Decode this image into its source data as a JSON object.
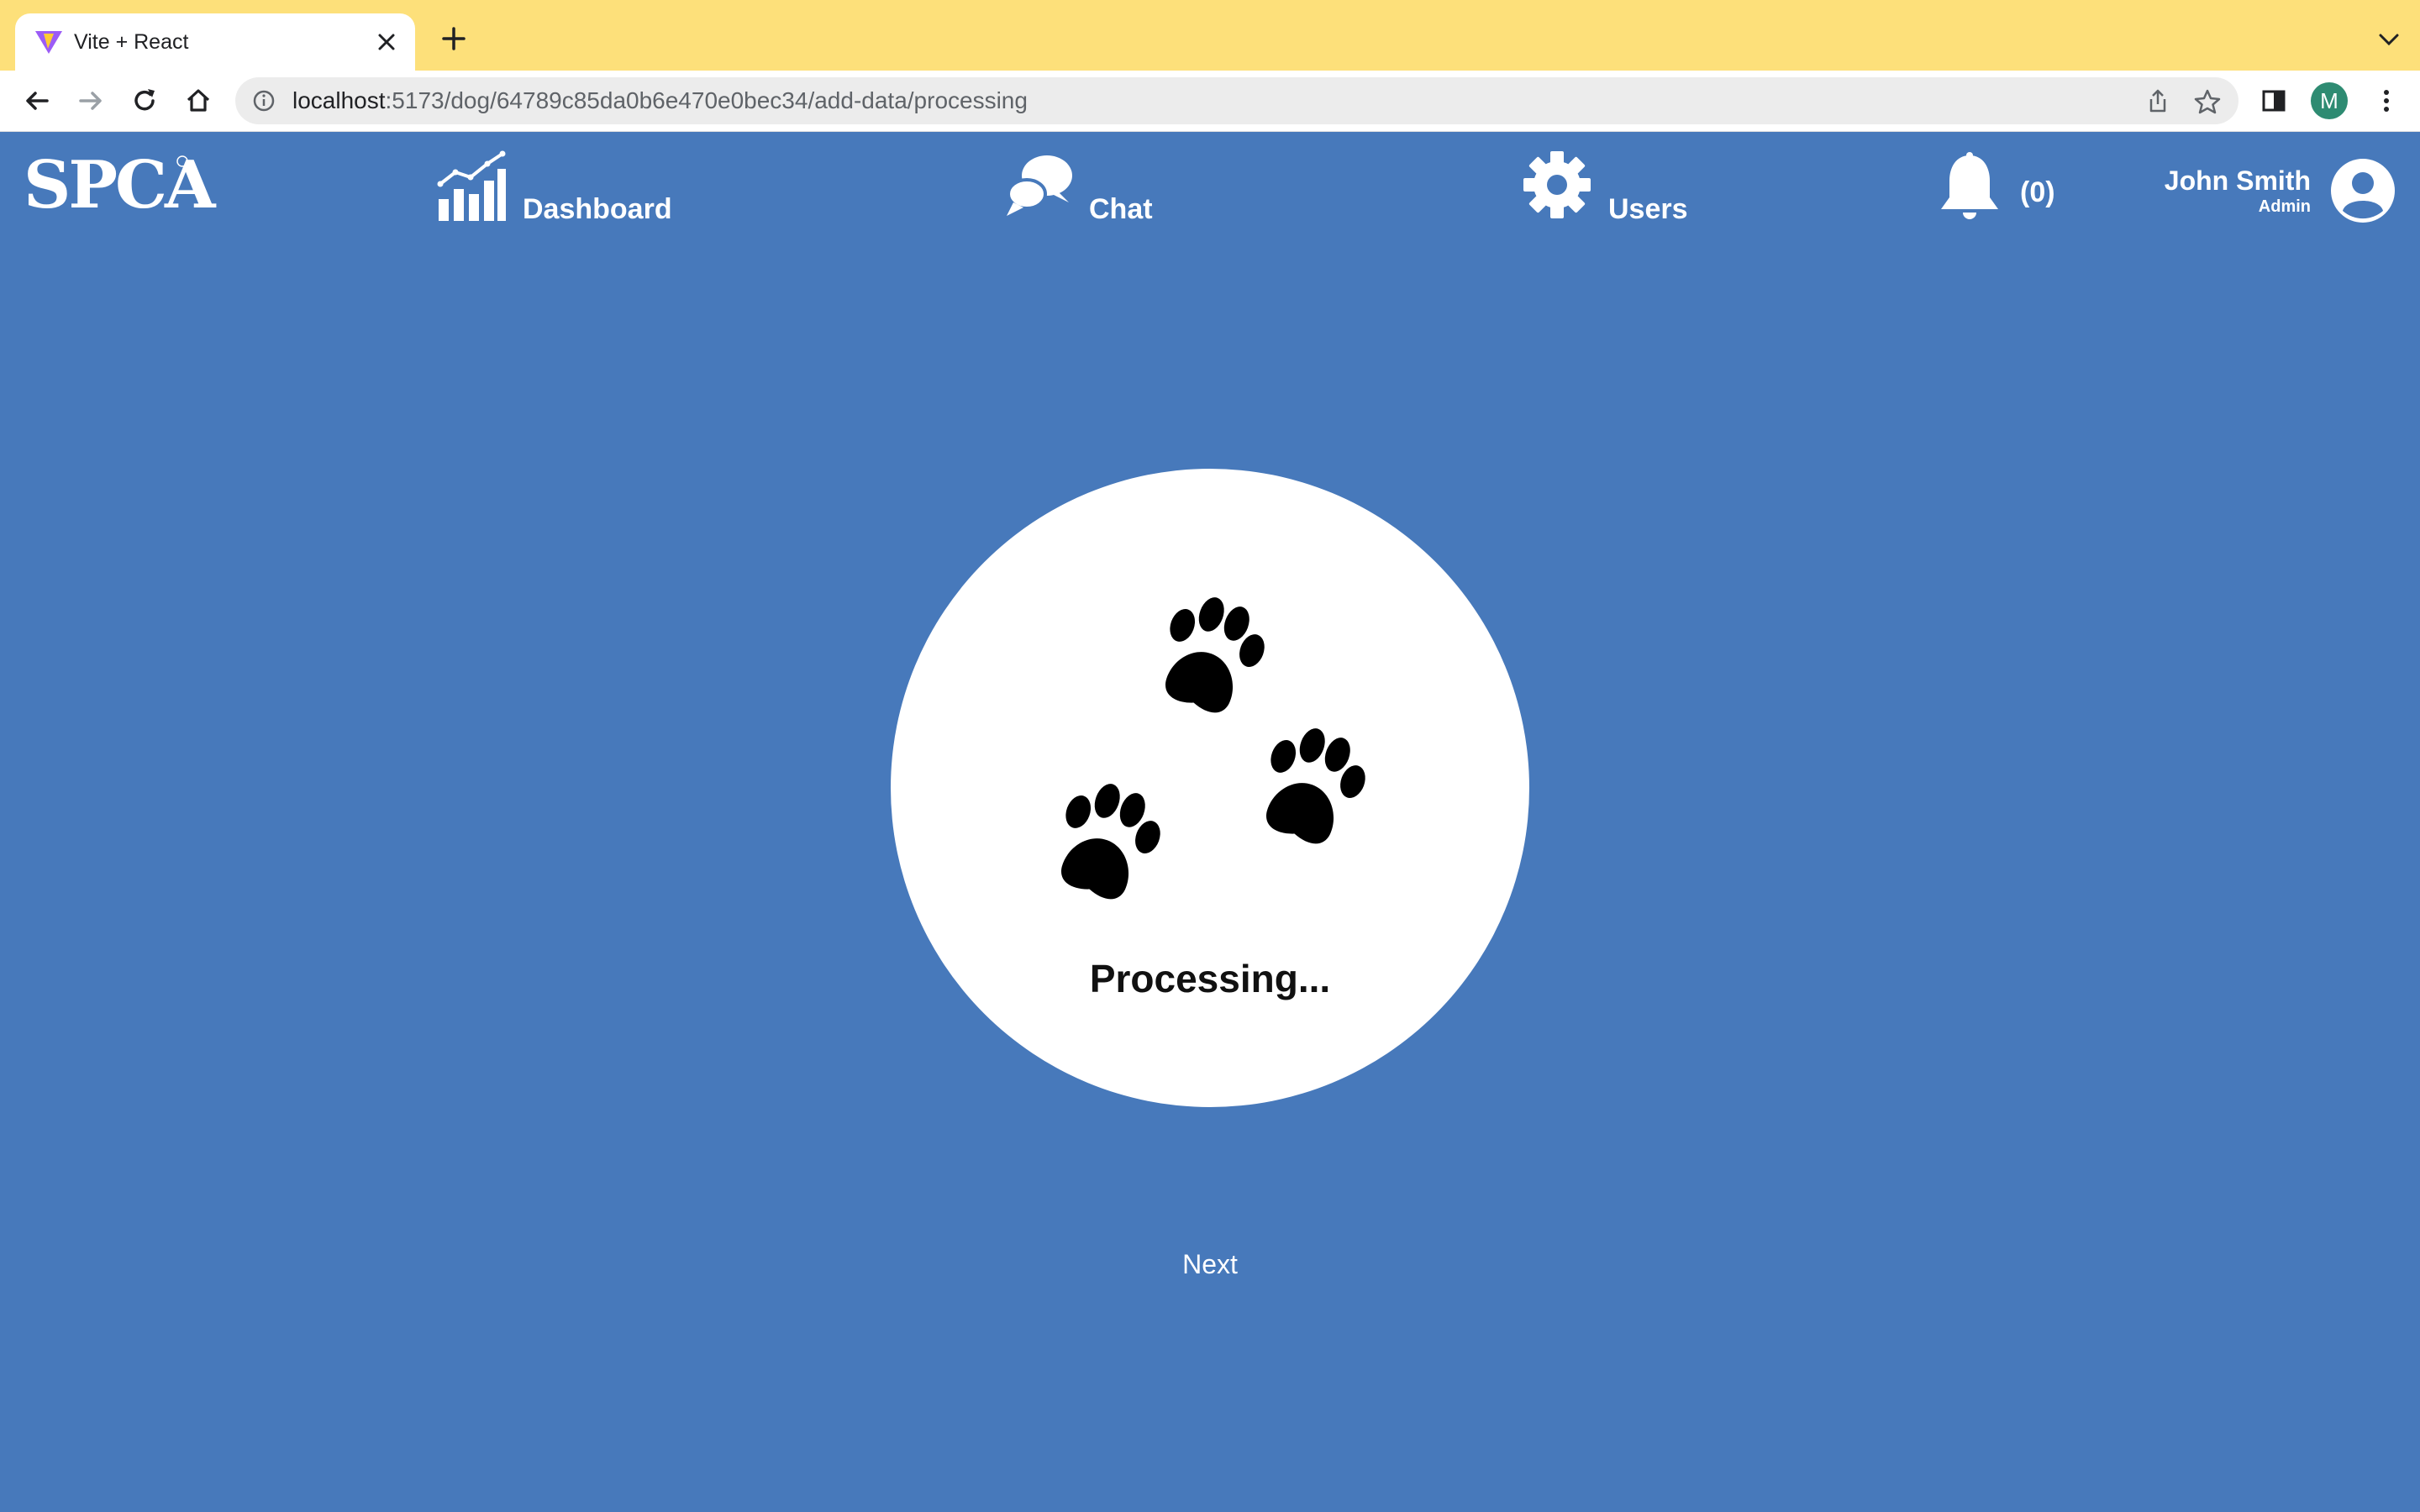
{
  "browser": {
    "tab_title": "Vite + React",
    "url_host": "localhost",
    "url_rest": ":5173/dog/64789c85da0b6e470e0bec34/add-data/processing",
    "profile_initial": "M",
    "profile_color": "#2e8b72",
    "tabstrip_color": "#fde07a"
  },
  "header": {
    "logo": "SPCA",
    "nav": {
      "dashboard": "Dashboard",
      "chat": "Chat",
      "users": "Users"
    },
    "notifications_count": "(0)",
    "user": {
      "name": "John Smith",
      "role": "Admin"
    },
    "background_color": "#4779bb"
  },
  "main": {
    "status_text": "Processing...",
    "next_label": "Next",
    "icons": [
      "paw-print-icon",
      "paw-print-icon",
      "paw-print-icon"
    ]
  }
}
